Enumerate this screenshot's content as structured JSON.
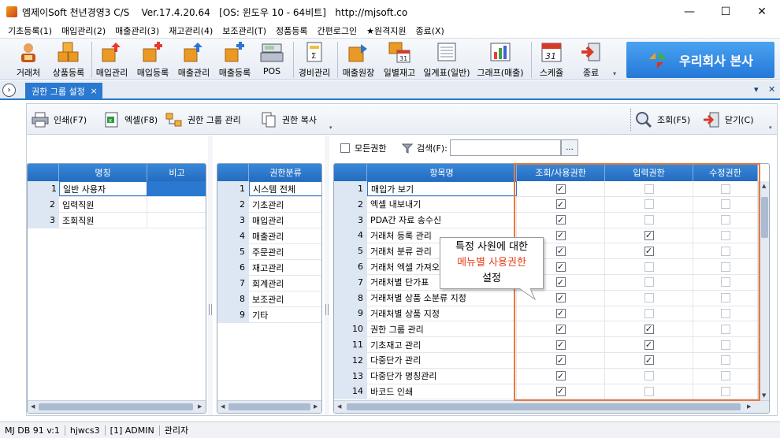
{
  "window": {
    "title": "엠제이Soft 천년경영3 C/S    Ver.17.4.20.64   [OS: 윈도우 10 - 64비트]   http://mjsoft.co",
    "minimize": "—",
    "maximize": "☐",
    "close": "✕"
  },
  "menu": [
    "기초등록(1)",
    "매입관리(2)",
    "매출관리(3)",
    "재고관리(4)",
    "보조관리(T)",
    "정품등록",
    "간편로그인",
    "★원격지원",
    "종료(X)"
  ],
  "toolbar": {
    "buttons": [
      "거래처",
      "상품등록",
      "매입관리",
      "매입등록",
      "매출관리",
      "매출등록",
      "POS",
      "경비관리",
      "매출원장",
      "일별재고",
      "일계표(일반)",
      "그래프(매출)",
      "스케쥴",
      "종료"
    ],
    "schedule_day": "31",
    "daily_day": "31",
    "brand": "우리회사 본사"
  },
  "tab": {
    "label": "권한 그룹 설정",
    "close": "×",
    "menu_arrow": "▾",
    "close_all": "✕"
  },
  "subtoolbar": {
    "print": "인쇄(F7)",
    "excel": "엑셀(F8)",
    "group_manage": "권한 그룹 관리",
    "copy": "권한 복사",
    "search": "조회(F5)",
    "close": "닫기(C)"
  },
  "filter": {
    "all_rights": "모든권한",
    "search_label": "검색(F):",
    "search_value": "",
    "browse": "..."
  },
  "groups": {
    "headers": [
      "",
      "명칭",
      "비고"
    ],
    "rows": [
      {
        "no": "1",
        "name": "일반 사용자"
      },
      {
        "no": "2",
        "name": "입력직원"
      },
      {
        "no": "3",
        "name": "조회직원"
      }
    ]
  },
  "categories": {
    "headers": [
      "",
      "권한분류"
    ],
    "rows": [
      {
        "no": "1",
        "name": "시스템 전체"
      },
      {
        "no": "2",
        "name": "기초관리"
      },
      {
        "no": "3",
        "name": "매입관리"
      },
      {
        "no": "4",
        "name": "매출관리"
      },
      {
        "no": "5",
        "name": "주문관리"
      },
      {
        "no": "6",
        "name": "재고관리"
      },
      {
        "no": "7",
        "name": "회계관리"
      },
      {
        "no": "8",
        "name": "보조관리"
      },
      {
        "no": "9",
        "name": "기타"
      }
    ]
  },
  "permissions": {
    "headers": [
      "",
      "항목명",
      "조회/사용권한",
      "입력권한",
      "수정권한"
    ],
    "rows": [
      {
        "no": "1",
        "name": "매입가 보기",
        "view": true,
        "input": false,
        "edit": false
      },
      {
        "no": "2",
        "name": "엑셀 내보내기",
        "view": true,
        "input": false,
        "edit": false
      },
      {
        "no": "3",
        "name": "PDA간 자료 송수신",
        "view": true,
        "input": false,
        "edit": false
      },
      {
        "no": "4",
        "name": "거래처 등록 관리",
        "view": true,
        "input": true,
        "edit": false
      },
      {
        "no": "5",
        "name": "거래처 분류 관리",
        "view": true,
        "input": true,
        "edit": false
      },
      {
        "no": "6",
        "name": "거래처 엑셀 가져오",
        "view": true,
        "input": false,
        "edit": false
      },
      {
        "no": "7",
        "name": "거래처별 단가표",
        "view": true,
        "input": false,
        "edit": false
      },
      {
        "no": "8",
        "name": "거래처별 상품 소분류 지정",
        "view": true,
        "input": false,
        "edit": false
      },
      {
        "no": "9",
        "name": "거래처별 상품 지정",
        "view": true,
        "input": false,
        "edit": false
      },
      {
        "no": "10",
        "name": "권한 그룹 관리",
        "view": true,
        "input": true,
        "edit": false
      },
      {
        "no": "11",
        "name": "기초재고 관리",
        "view": true,
        "input": true,
        "edit": false
      },
      {
        "no": "12",
        "name": "다중단가 관리",
        "view": true,
        "input": true,
        "edit": false
      },
      {
        "no": "13",
        "name": "다중단가 명칭관리",
        "view": true,
        "input": false,
        "edit": false
      },
      {
        "no": "14",
        "name": "바코드 인쇄",
        "view": true,
        "input": false,
        "edit": false
      }
    ]
  },
  "callout": {
    "line1": "특정 사원에 대한",
    "line2": "메뉴별 사용권한",
    "line3": "설정"
  },
  "status": [
    "MJ DB 91 v:1",
    "hjwcs3",
    "[1] ADMIN",
    "관리자"
  ],
  "colors": {
    "header_blue": "#246cc0",
    "highlight": "#e87a3c",
    "callout_red": "#e8401c"
  }
}
